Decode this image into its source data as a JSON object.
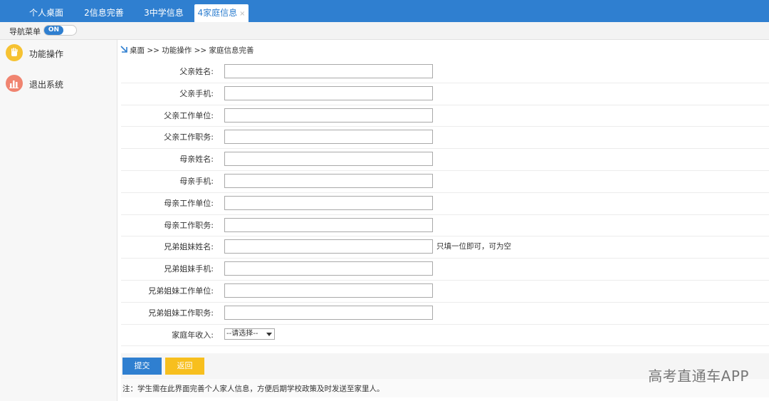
{
  "tabs": [
    {
      "label": "个人桌面"
    },
    {
      "label": "2信息完善"
    },
    {
      "label": "3中学信息"
    },
    {
      "label": "4家庭信息",
      "close": "×"
    }
  ],
  "nav": {
    "label": "导航菜单",
    "toggle": "ON"
  },
  "sidebar": {
    "items": [
      {
        "label": "功能操作",
        "icon": "hand-icon"
      },
      {
        "label": "退出系统",
        "icon": "chart-icon"
      }
    ]
  },
  "breadcrumb": "桌面 >> 功能操作 >> 家庭信息完善",
  "form": {
    "fields": [
      {
        "label": "父亲姓名:",
        "value": ""
      },
      {
        "label": "父亲手机:",
        "value": ""
      },
      {
        "label": "父亲工作单位:",
        "value": ""
      },
      {
        "label": "父亲工作职务:",
        "value": ""
      },
      {
        "label": "母亲姓名:",
        "value": ""
      },
      {
        "label": "母亲手机:",
        "value": ""
      },
      {
        "label": "母亲工作单位:",
        "value": ""
      },
      {
        "label": "母亲工作职务:",
        "value": ""
      },
      {
        "label": "兄弟姐妹姓名:",
        "value": "",
        "hint": "只填一位即可，可为空"
      },
      {
        "label": "兄弟姐妹手机:",
        "value": ""
      },
      {
        "label": "兄弟姐妹工作单位:",
        "value": ""
      },
      {
        "label": "兄弟姐妹工作职务:",
        "value": ""
      }
    ],
    "income": {
      "label": "家庭年收入:",
      "selected": "--请选择--"
    }
  },
  "buttons": {
    "submit": "提交",
    "back": "返回"
  },
  "note": "注：学生需在此界面完善个人家人信息，方便后期学校政策及时发送至家里人。",
  "watermark": "高考直通车APP",
  "colors": {
    "primary": "#2f7fd0",
    "accent": "#f7bf1e"
  }
}
